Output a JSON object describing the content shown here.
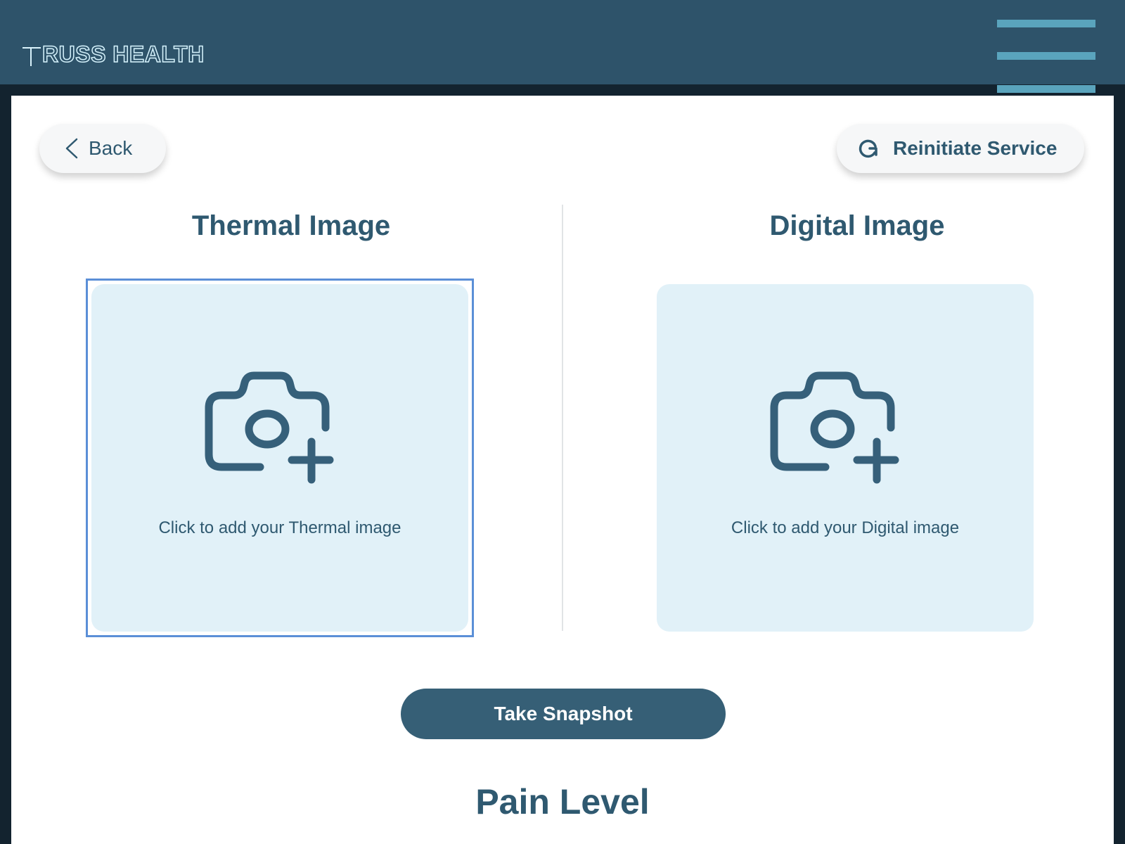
{
  "header": {
    "logo_text": "RUSS HEALTH",
    "logo_full": "TRUSS HEALTH",
    "menu_icon": "hamburger-menu-icon"
  },
  "toolbar": {
    "back_label": "Back",
    "back_icon": "chevron-left-icon",
    "reinitiate_label": "Reinitiate Service",
    "reinitiate_icon": "refresh-icon"
  },
  "thermal": {
    "title": "Thermal Image",
    "prompt": "Click to add your Thermal image",
    "icon": "camera-add-icon",
    "focused": true
  },
  "digital": {
    "title": "Digital Image",
    "prompt": "Click to add your Digital image",
    "icon": "camera-add-icon"
  },
  "actions": {
    "snapshot_label": "Take Snapshot"
  },
  "pain": {
    "title": "Pain Level"
  },
  "colors": {
    "header_bg": "#2e536a",
    "accent": "#365f76",
    "menu_bars": "#5aa4bd",
    "upload_bg": "#e1f1f8",
    "focus_ring": "#5b8fd7",
    "text": "#2f5970"
  }
}
